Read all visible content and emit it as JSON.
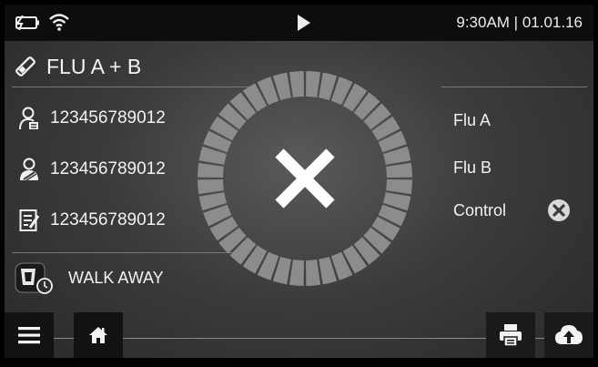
{
  "status_bar": {
    "time_date": "9:30AM | 01.01.16",
    "icons": [
      "battery-charging-icon",
      "wifi-icon",
      "play-icon"
    ]
  },
  "test": {
    "icon": "test-strip-icon",
    "name": "FLU A + B"
  },
  "info": [
    {
      "icon": "patient-id-icon",
      "value": "123456789012"
    },
    {
      "icon": "operator-id-icon",
      "value": "123456789012"
    },
    {
      "icon": "sample-id-icon",
      "value": "123456789012"
    }
  ],
  "mode": {
    "icon": "walk-away-timer-icon",
    "label": "WALK AWAY"
  },
  "result_status": {
    "icon": "invalid-x-icon",
    "progress_segments": 40
  },
  "results": [
    {
      "label": "Flu A",
      "status": ""
    },
    {
      "label": "Flu B",
      "status": ""
    },
    {
      "label": "Control",
      "status": "invalid",
      "status_icon": "circle-x-icon"
    }
  ],
  "toolbar": {
    "menu_icon": "hamburger-menu-icon",
    "home_icon": "home-icon",
    "print_icon": "printer-icon",
    "upload_icon": "cloud-upload-icon"
  },
  "colors": {
    "background": "#3b3b3b",
    "status_bar": "#0d0d0d",
    "dial_segment": "#8c8c8c",
    "text": "#f2f2f2"
  }
}
